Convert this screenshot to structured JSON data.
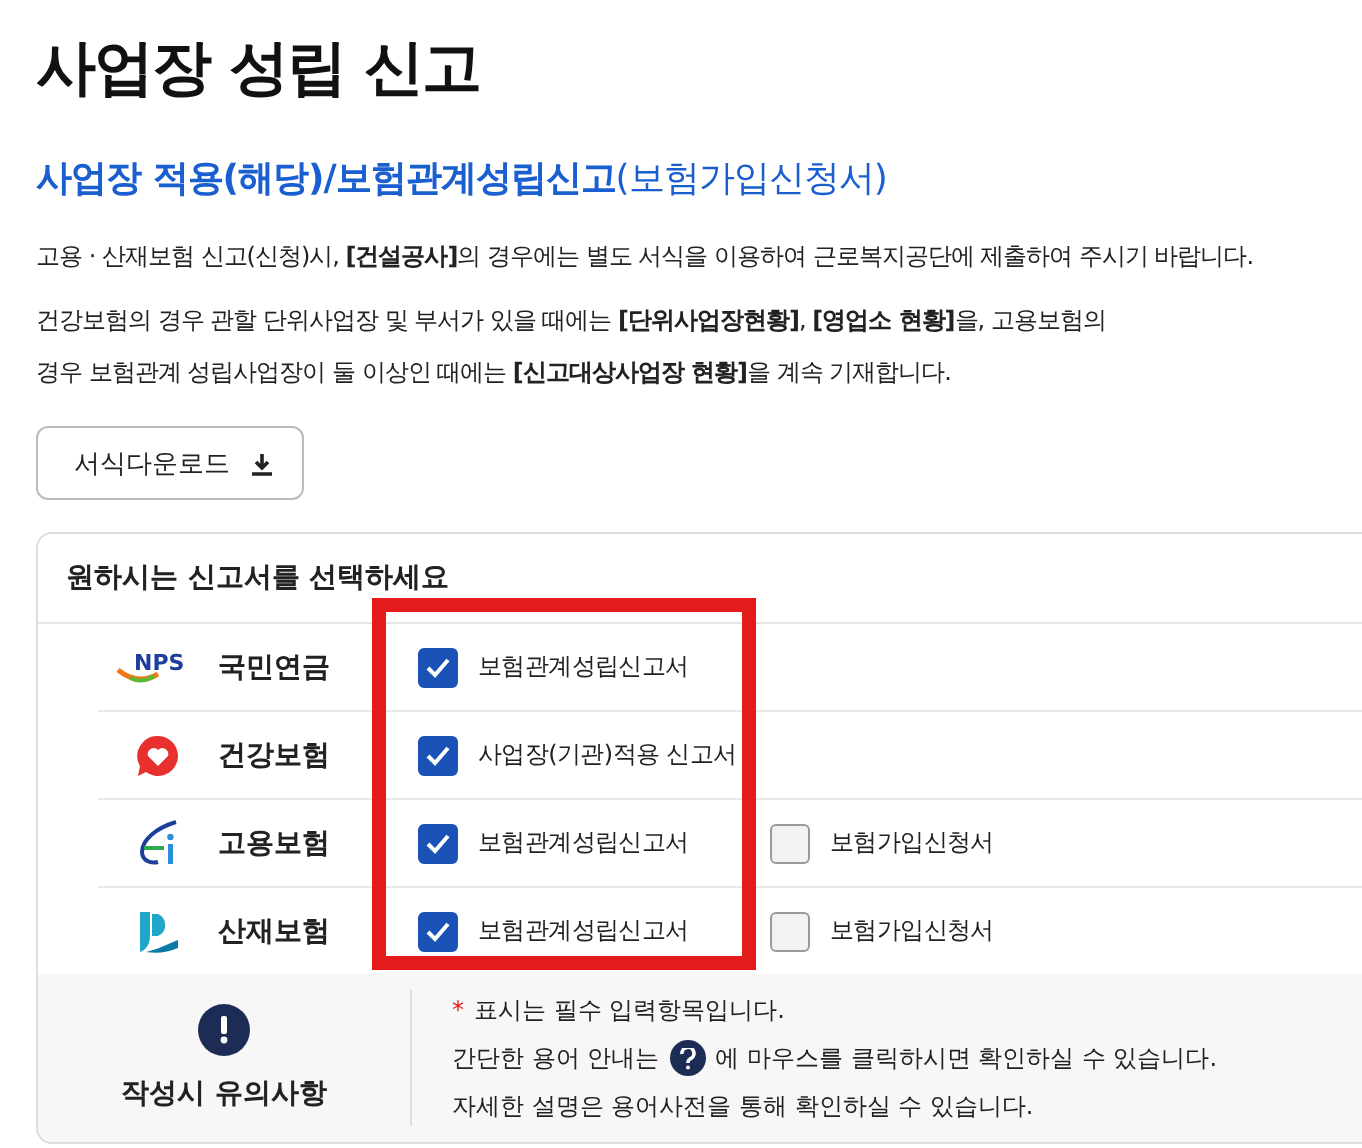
{
  "page_title": "사업장 성립 신고",
  "subtitle": {
    "main": "사업장 적용(해당)/보험관계성립신고",
    "sub": "(보험가입신청서)"
  },
  "paragraphs": [
    "고용 · 산재보험 신고(신청)시, **[건설공사]**의 경우에는 별도 서식을 이용하여 근로복지공단에 제출하여 주시기 바랍니다.",
    "건강보험의 경우 관할 단위사업장 및 부서가 있을 때에는 **[단위사업장현황]**,  **[영업소 현황]**을,  고용보험의\n경우 보험관계 성립사업장이 둘 이상인 때에는 **[신고대상사업장 현황]**을 계속 기재합니다."
  ],
  "download_button": "서식다운로드",
  "form": {
    "heading": "원하시는 신고서를 선택하세요",
    "highlighted": true,
    "rows": [
      {
        "kind": "nps",
        "logo_text": "NPS",
        "name": "국민연금",
        "options": [
          {
            "label": "보험관계성립신고서",
            "checked": true
          }
        ]
      },
      {
        "kind": "health",
        "name": "건강보험",
        "options": [
          {
            "label": "사업장(기관)적용 신고서",
            "checked": true
          }
        ]
      },
      {
        "kind": "employment",
        "name": "고용보험",
        "options": [
          {
            "label": "보험관계성립신고서",
            "checked": true
          },
          {
            "label": "보험가입신청서",
            "checked": false
          }
        ]
      },
      {
        "kind": "accident",
        "name": "산재보험",
        "options": [
          {
            "label": "보험관계성립신고서",
            "checked": true
          },
          {
            "label": "보험가입신청서",
            "checked": false
          }
        ]
      }
    ]
  },
  "notes": {
    "title": "작성시 유의사항",
    "lines": [
      {
        "kind": "required",
        "mark": "*",
        "text": "표시는 필수 입력항목입니다."
      },
      {
        "kind": "help",
        "before": "간단한 용어 안내는",
        "after": "에 마우스를 클릭하시면 확인하실 수 있습니다."
      },
      {
        "kind": "plain",
        "text": "자세한 설명은 용어사전을 통해 확인하실 수 있습니다."
      }
    ]
  }
}
